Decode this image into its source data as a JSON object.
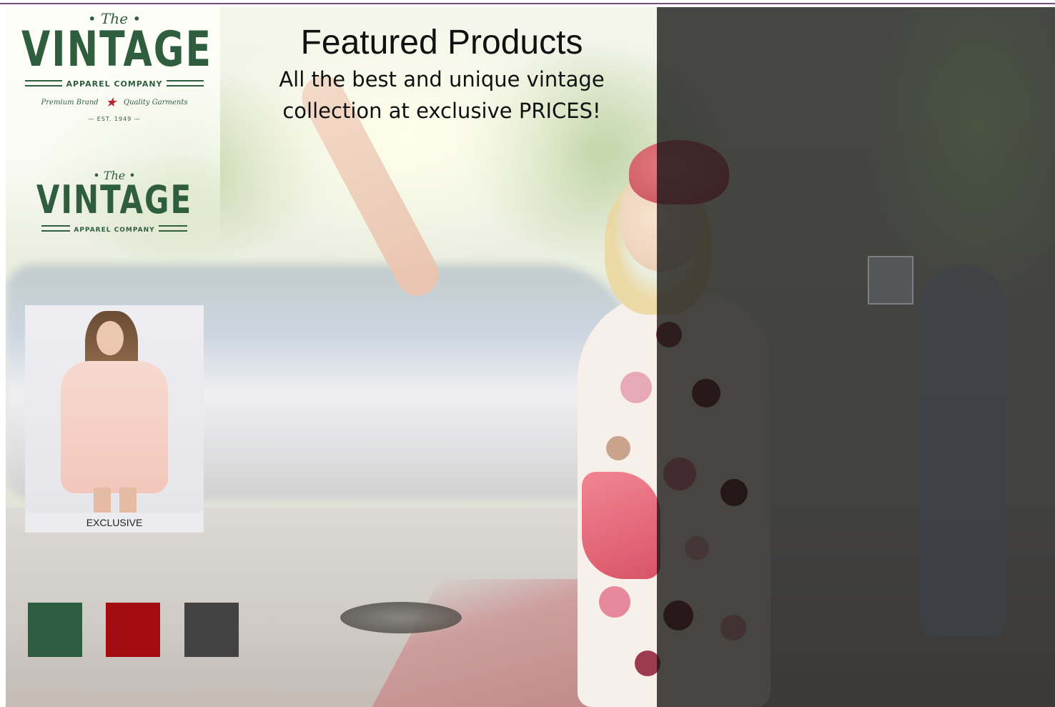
{
  "heading": {
    "title": "Featured Products",
    "subtitle_line1": "All the best and unique vintage",
    "subtitle_line2": "collection at exclusive PRICES!"
  },
  "logo_primary": {
    "the": "• The •",
    "word": "VINTAGE",
    "company": "APPAREL COMPANY",
    "left_tag": "Premium Brand",
    "right_tag": "Quality Garments",
    "est": "— EST. 1949 —"
  },
  "logo_secondary": {
    "the": "• The •",
    "word": "VINTAGE",
    "company": "APPAREL COMPANY"
  },
  "product": {
    "caption": "EXCLUSIVE"
  },
  "swatches": [
    {
      "name": "green",
      "color": "#2e5e3f"
    },
    {
      "name": "red",
      "color": "#a30d12"
    },
    {
      "name": "charcoal",
      "color": "#434343"
    }
  ],
  "colors": {
    "accent_rule": "#6b4f7f",
    "logo_green": "#2f5e3e",
    "star_red": "#b3242b"
  }
}
